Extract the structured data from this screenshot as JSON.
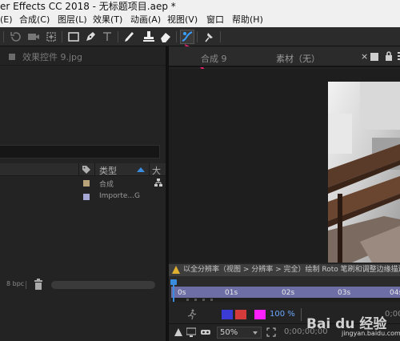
{
  "window": {
    "title": "er Effects CC 2018 - 无标题项目.aep *"
  },
  "menu": {
    "items": [
      {
        "label": "(E)"
      },
      {
        "label": "合成(C)"
      },
      {
        "label": "图层(L)"
      },
      {
        "label": "效果(T)"
      },
      {
        "label": "动画(A)"
      },
      {
        "label": "视图(V)"
      },
      {
        "label": "窗口"
      },
      {
        "label": "帮助(H)"
      }
    ]
  },
  "toolbar": {
    "tools": [
      "rotate-icon",
      "camera-icon",
      "pan-behind-icon",
      "rectangle-icon",
      "pen-icon",
      "type-icon",
      "brush-icon",
      "clone-stamp-icon",
      "eraser-icon",
      "roto-brush-icon",
      "puppet-pin-icon"
    ],
    "highlighted_tool": "roto-brush-icon",
    "annotation_color": "#e0206a"
  },
  "effects_panel": {
    "label": "效果控件 9.jpg"
  },
  "project_panel": {
    "column_type": "类型",
    "column_size": "大",
    "rows": [
      {
        "type": "合成",
        "swatch": "#b9a37a",
        "icon": "flowchart-icon"
      },
      {
        "type": "Importe...G",
        "swatch": "#a7a7d6",
        "icon": ""
      }
    ]
  },
  "footer": {
    "bpc": "8 bpc"
  },
  "viewer": {
    "tab_composition": "合成 9",
    "tab_footage": "素材（无）"
  },
  "timeline": {
    "warning": "以全分辨率（视图 > 分辨率 > 完全）绘制 Roto 笔刷和调整边缘描边以",
    "ticks": [
      "0s",
      "01s",
      "02s",
      "03s",
      "04s"
    ],
    "percent": "100 %",
    "time_end": "0;00"
  },
  "status": {
    "zoom": "50%",
    "time": "0;00;00;00",
    "watermark_brand": "Bai du 经验",
    "watermark_url": "jingyan.baidu.com"
  }
}
